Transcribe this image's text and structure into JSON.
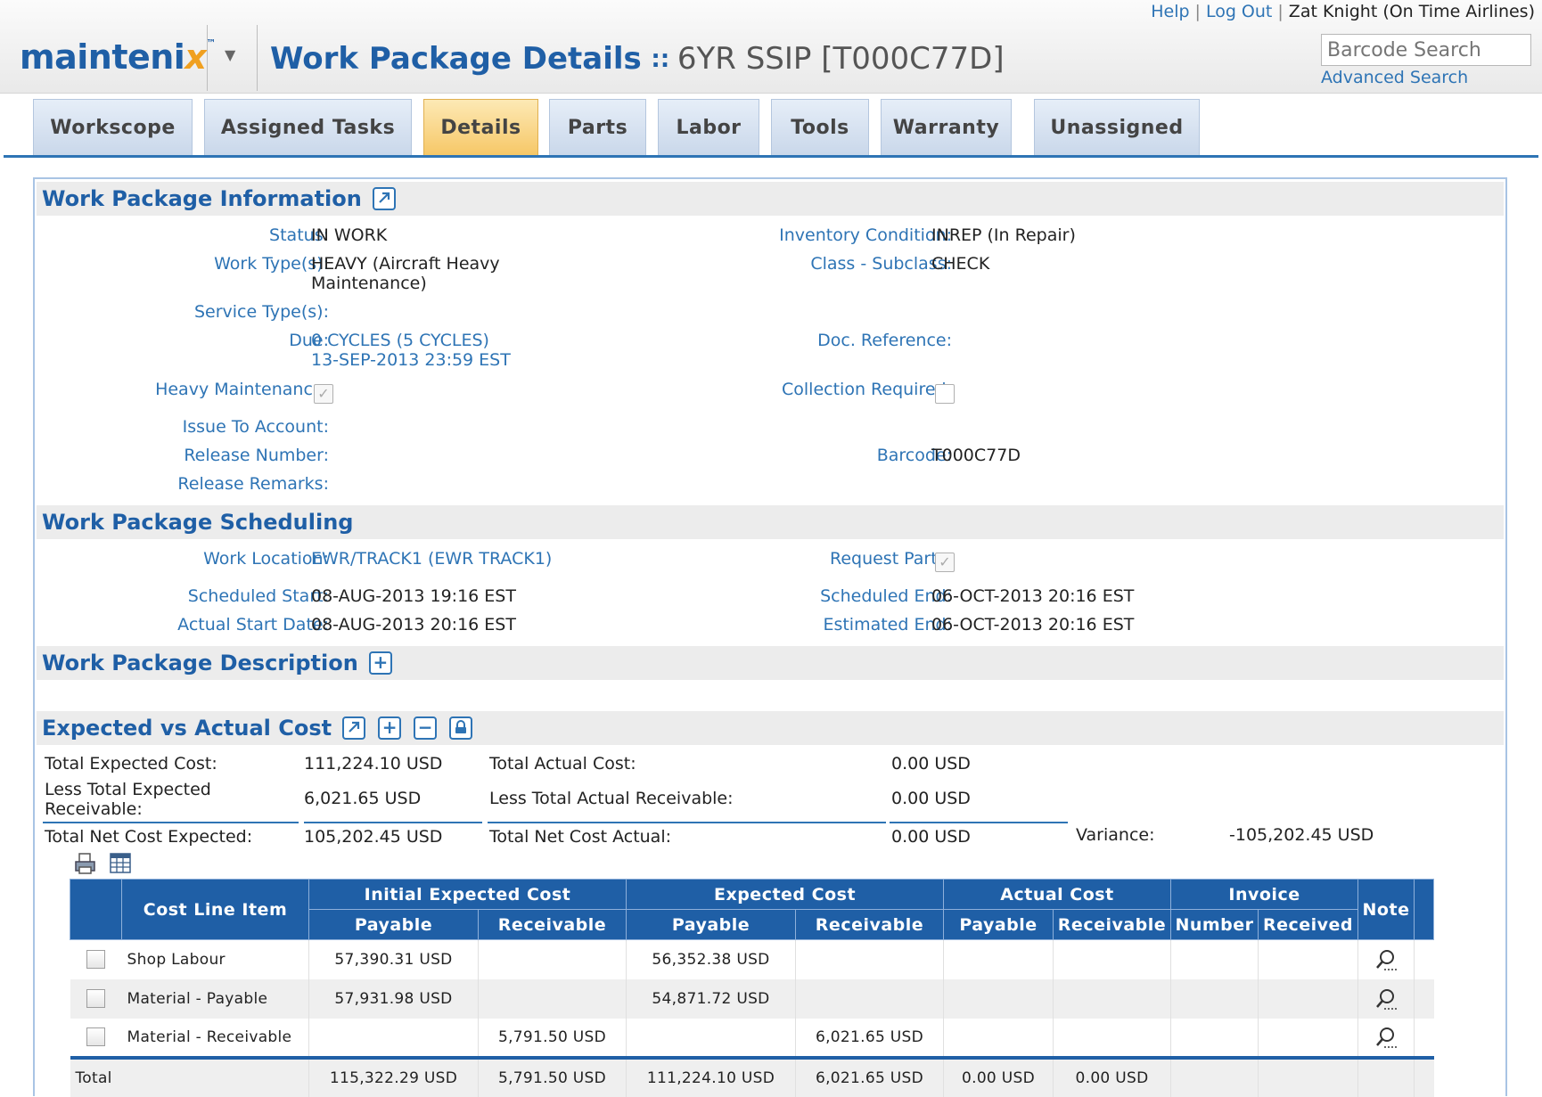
{
  "header": {
    "help": "Help",
    "logout": "Log Out",
    "user": "Zat Knight (On Time Airlines)",
    "logo_main": "mainteni",
    "logo_x": "x",
    "logo_tm": "™",
    "page_title": "Work Package Details",
    "title_arrow": "∷",
    "subject": "6YR SSIP [T000C77D]",
    "barcode_placeholder": "Barcode Search",
    "advanced_search": "Advanced Search"
  },
  "tabs": [
    "Workscope",
    "Assigned Tasks",
    "Details",
    "Parts",
    "Labor",
    "Tools",
    "Warranty",
    "Unassigned"
  ],
  "active_tab": "Details",
  "info": {
    "title": "Work Package Information",
    "status_label": "Status:",
    "status": "IN WORK",
    "worktype_label": "Work Type(s):",
    "worktype_line1": "HEAVY (Aircraft Heavy",
    "worktype_line2": "Maintenance)",
    "service_label": "Service Type(s):",
    "due_label": "Due:",
    "due_line1": "0 CYCLES (5 CYCLES)",
    "due_line2": "13-SEP-2013 23:59 EST",
    "heavy_label": "Heavy Maintenance:",
    "heavy_checked": true,
    "issue_label": "Issue To Account:",
    "release_num_label": "Release Number:",
    "release_rem_label": "Release Remarks:",
    "inv_cond_label": "Inventory Condition:",
    "inv_cond": "INREP (In Repair)",
    "class_label": "Class - Subclass:",
    "class": "CHECK",
    "doc_ref_label": "Doc. Reference:",
    "collection_label": "Collection Required:",
    "collection_checked": false,
    "barcode_label": "Barcode:",
    "barcode": "T000C77D"
  },
  "scheduling": {
    "title": "Work Package Scheduling",
    "location_label": "Work Location:",
    "location": "EWR/TRACK1 (EWR TRACK1)",
    "sched_start_label": "Scheduled Start:",
    "sched_start": "08-AUG-2013 19:16 EST",
    "actual_start_label": "Actual Start Date:",
    "actual_start": "08-AUG-2013 20:16 EST",
    "request_parts_label": "Request Parts:",
    "request_parts_checked": true,
    "sched_end_label": "Scheduled End:",
    "sched_end": "06-OCT-2013 20:16 EST",
    "est_end_label": "Estimated End:",
    "est_end": "06-OCT-2013 20:16 EST"
  },
  "description": {
    "title": "Work Package Description"
  },
  "cost": {
    "title": "Expected vs Actual Cost",
    "total_expected_label": "Total Expected Cost:",
    "total_expected": "111,224.10 USD",
    "less_expected_label_1": "Less Total Expected",
    "less_expected_label_2": "Receivable:",
    "less_expected": "6,021.65 USD",
    "net_expected_label": "Total Net Cost Expected:",
    "net_expected": "105,202.45 USD",
    "total_actual_label": "Total Actual Cost:",
    "total_actual": "0.00 USD",
    "less_actual_label": "Less Total Actual Receivable:",
    "less_actual": "0.00 USD",
    "net_actual_label": "Total Net Cost Actual:",
    "net_actual": "0.00 USD",
    "variance_label": "Variance:",
    "variance": "-105,202.45 USD"
  },
  "grid": {
    "headers": {
      "cost_line_item": "Cost Line Item",
      "initial_expected": "Initial Expected Cost",
      "expected": "Expected Cost",
      "actual": "Actual Cost",
      "invoice": "Invoice",
      "note": "Note",
      "payable": "Payable",
      "receivable": "Receivable",
      "number": "Number",
      "received": "Received"
    },
    "rows": [
      {
        "item": "Shop Labour",
        "iec_pay": "57,390.31 USD",
        "iec_rec": "",
        "ec_pay": "56,352.38 USD",
        "ec_rec": "",
        "ac_pay": "",
        "ac_rec": "",
        "inv_num": "",
        "inv_rec": ""
      },
      {
        "item": "Material - Payable",
        "iec_pay": "57,931.98 USD",
        "iec_rec": "",
        "ec_pay": "54,871.72 USD",
        "ec_rec": "",
        "ac_pay": "",
        "ac_rec": "",
        "inv_num": "",
        "inv_rec": ""
      },
      {
        "item": "Material - Receivable",
        "iec_pay": "",
        "iec_rec": "5,791.50 USD",
        "ec_pay": "",
        "ec_rec": "6,021.65 USD",
        "ac_pay": "",
        "ac_rec": "",
        "inv_num": "",
        "inv_rec": ""
      }
    ],
    "total": {
      "label": "Total",
      "iec_pay": "115,322.29 USD",
      "iec_rec": "5,791.50 USD",
      "ec_pay": "111,224.10 USD",
      "ec_rec": "6,021.65 USD",
      "ac_pay": "0.00 USD",
      "ac_rec": "0.00 USD"
    }
  },
  "colors": {
    "brand_blue": "#1f5fa6",
    "link": "#2e74b5",
    "active_tab": "#f6c766",
    "logo_accent": "#f0a020"
  }
}
